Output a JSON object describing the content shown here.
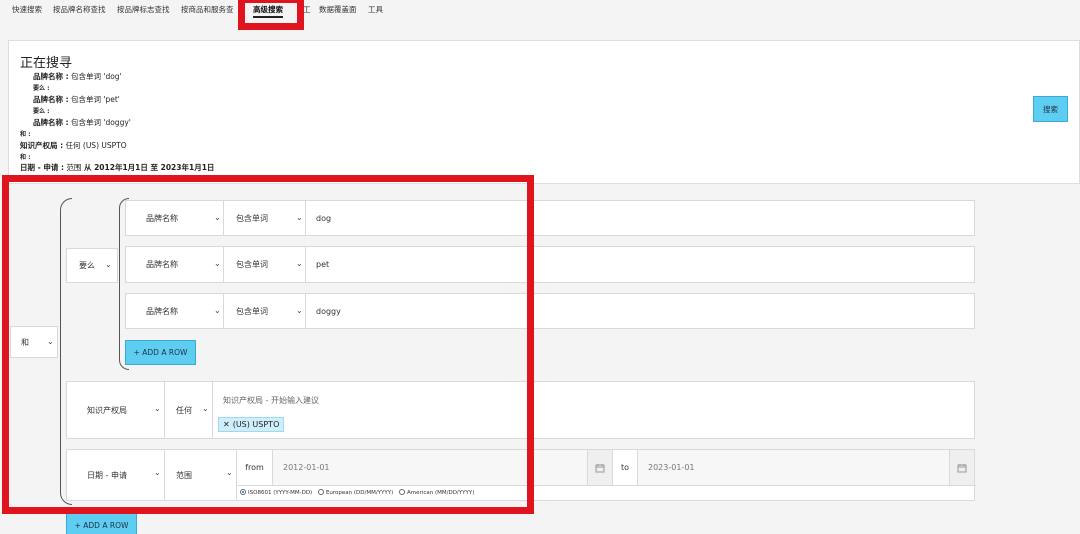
{
  "nav": {
    "items": [
      "快速搜索",
      "按品牌名称查找",
      "按品牌标志查找",
      "按商品和服务查",
      "高级搜索",
      "工具"
    ],
    "partial_hidden": [
      "工",
      "数据覆盖面"
    ],
    "active": "高级搜索"
  },
  "current_search": {
    "title": "正在搜寻",
    "lines": [
      {
        "label": "品牌名称 :",
        "value": " 包含单词 'dog'"
      },
      {
        "label": "要么 :",
        "value": ""
      },
      {
        "label": "品牌名称 :",
        "value": " 包含单词 'pet'"
      },
      {
        "label": "要么 :",
        "value": ""
      },
      {
        "label": "品牌名称 :",
        "value": " 包含单词 'doggy'"
      },
      {
        "label": "和 :",
        "value": ""
      },
      {
        "label": "知识产权局 :",
        "value": " 任何 (US) USPTO"
      },
      {
        "label": "和 :",
        "value": ""
      },
      {
        "label": "日期 - 申请 :",
        "value": " 范围",
        "extra": " 从 2012年1月1日 至 2023年1月1日"
      }
    ],
    "search_button": "搜索"
  },
  "builder": {
    "outer_operator": "和",
    "group_operator": "要么",
    "rows": [
      {
        "field": "品牌名称",
        "op": "包含单词",
        "value": "dog"
      },
      {
        "field": "品牌名称",
        "op": "包含单词",
        "value": "pet"
      },
      {
        "field": "品牌名称",
        "op": "包含单词",
        "value": "doggy"
      }
    ],
    "add_row_inner": "+ ADD A ROW",
    "office_row": {
      "field": "知识产权局",
      "op": "任何",
      "placeholder": "知识产权局 - 开始输入建议",
      "chip": "(US) USPTO",
      "chip_remove": "✕"
    },
    "date_row": {
      "field": "日期 - 申请",
      "op": "范围",
      "from_label": "from",
      "from_value": "2012-01-01",
      "to_label": "to",
      "to_value": "2023-01-01",
      "formats": [
        "ISO8601 (YYYY-MM-DD)",
        "European (DD/MM/YYYY)",
        "American (MM/DD/YYYY)"
      ],
      "selected_format": "ISO8601 (YYYY-MM-DD)"
    },
    "add_row_outer": "+ ADD A ROW"
  },
  "colors": {
    "highlight_red": "#e0141e",
    "button_blue": "#5ecdf2"
  }
}
